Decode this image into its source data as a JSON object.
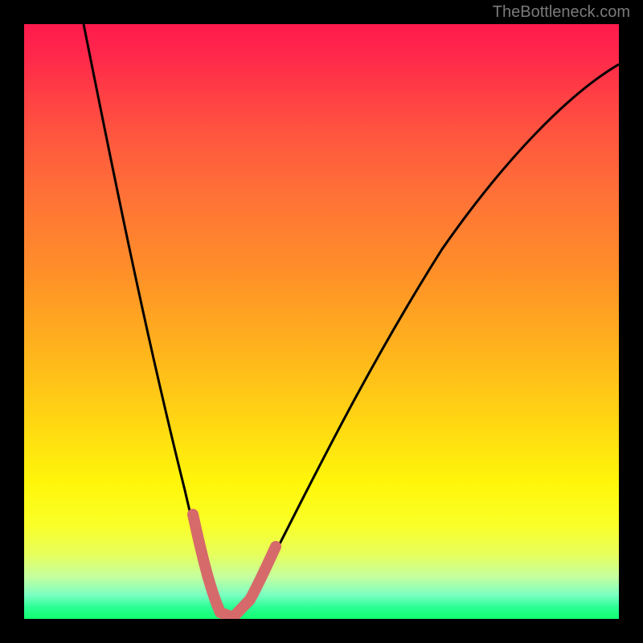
{
  "watermark": "TheBottleneck.com",
  "colors": {
    "frame": "#000000",
    "grad_top": "#ff1a4d",
    "grad_bottom": "#12ff70",
    "curve": "#000000",
    "marker": "#d66a6a"
  },
  "chart_data": {
    "type": "line",
    "title": "",
    "xlabel": "",
    "ylabel": "",
    "xlim": [
      0,
      100
    ],
    "ylim": [
      0,
      100
    ],
    "legend": false,
    "grid": false,
    "series": [
      {
        "name": "bottleneck-curve",
        "x": [
          10,
          12,
          14,
          16,
          18,
          20,
          22,
          24,
          26,
          28,
          30,
          32,
          34,
          36,
          38,
          40,
          45,
          50,
          55,
          60,
          65,
          70,
          75,
          80,
          85,
          90,
          95,
          100
        ],
        "y": [
          100,
          90,
          80,
          70,
          61,
          52,
          44,
          36,
          28,
          19,
          10,
          4,
          0,
          0,
          3,
          9,
          21,
          32,
          42,
          50,
          57,
          63,
          68,
          72,
          76,
          79,
          82,
          84
        ]
      }
    ],
    "markers": [
      {
        "name": "highlight-segment-left",
        "x_range": [
          28,
          33
        ],
        "y_range": [
          2,
          19
        ]
      },
      {
        "name": "highlight-segment-bottom",
        "x_range": [
          33,
          38
        ],
        "y_range": [
          0,
          3
        ]
      },
      {
        "name": "highlight-segment-right",
        "x_range": [
          38,
          42
        ],
        "y_range": [
          3,
          13
        ]
      }
    ],
    "notes": "Values estimated from pixel geometry; axes unlabeled in source."
  }
}
